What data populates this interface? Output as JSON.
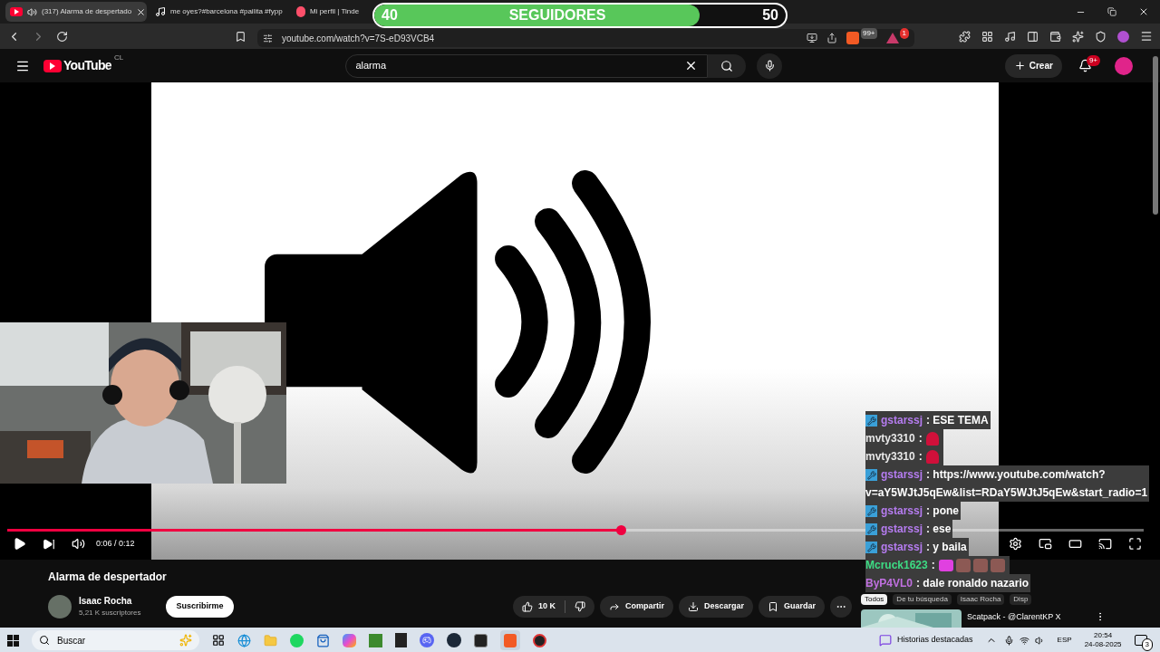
{
  "browser": {
    "tabs": [
      {
        "title": "(317) Alarma de despertado",
        "selected": true,
        "kind": "youtube",
        "audio": true
      },
      {
        "title": "me oyes?#barcelona #pailita #fypp",
        "selected": false,
        "kind": "tiktok",
        "audio": false
      },
      {
        "title": "Mi perfil | Tinde",
        "selected": false,
        "kind": "tinder",
        "audio": false
      }
    ],
    "url": "youtube.com/watch?v=7S-eD93VCB4",
    "shields_badge": "99+",
    "alert_badge": "1"
  },
  "follower_goal": {
    "current": "40",
    "label": "SEGUIDORES",
    "goal": "50",
    "level": 0.79
  },
  "youtube": {
    "logo": "YouTube",
    "region": "CL",
    "search": "alarma",
    "create": "Crear",
    "notifications": "9+"
  },
  "player": {
    "time": "0:06 / 0:12",
    "level": 0.54
  },
  "chat": [
    {
      "user": "gstarssj",
      "color": "#b57cf0",
      "badge": true,
      "message": ": ESE TEMA"
    },
    {
      "user": "mvty3310",
      "color": "#e8e8e8",
      "message": ":",
      "emotes": [
        {
          "kind": "siren"
        }
      ]
    },
    {
      "user": "mvty3310",
      "color": "#e8e8e8",
      "message": ":",
      "emotes": [
        {
          "kind": "siren"
        }
      ]
    },
    {
      "user": "gstarssj",
      "color": "#b57cf0",
      "badge": true,
      "message": ": https://www.youtube.com/watch?",
      "continuation": "v=aY5WJtJ5qEw&list=RDaY5WJtJ5qEw&start_radio=1"
    },
    {
      "user": "gstarssj",
      "color": "#b57cf0",
      "badge": true,
      "message": ": pone"
    },
    {
      "user": "gstarssj",
      "color": "#b57cf0",
      "badge": true,
      "message": ": ese"
    },
    {
      "user": "gstarssj",
      "color": "#b57cf0",
      "badge": true,
      "message": ": y baila"
    },
    {
      "user": "Mcruck1623",
      "color": "#3ddc84",
      "message": ":",
      "emotes": [
        {
          "kind": "face"
        },
        {
          "kind": "blurred"
        },
        {
          "kind": "blurred"
        },
        {
          "kind": "blurred"
        }
      ]
    },
    {
      "user": "ByP4VL0",
      "color": "#c070e0",
      "message": ": dale ronaldo nazario"
    }
  ],
  "video": {
    "title": "Alarma de despertador",
    "channel": "Isaac Rocha",
    "subscribers": "5,21 K suscriptores",
    "subscribe": "Suscribirme",
    "likes": "10 K",
    "actions": [
      "Compartir",
      "Descargar",
      "Guardar"
    ]
  },
  "chips": [
    {
      "label": "Todos",
      "selected": true
    },
    {
      "label": "De tu búsqueda",
      "selected": false
    },
    {
      "label": "Isaac Rocha",
      "selected": false
    },
    {
      "label": "Disp",
      "selected": false
    }
  ],
  "recommendation": {
    "title": "Scatpack - @ClarentKP X"
  },
  "taskbar": {
    "search": "Buscar",
    "news": "Historias destacadas",
    "language": "ESP",
    "time": "20:54",
    "date": "24-08-2025",
    "notifications": "3"
  }
}
